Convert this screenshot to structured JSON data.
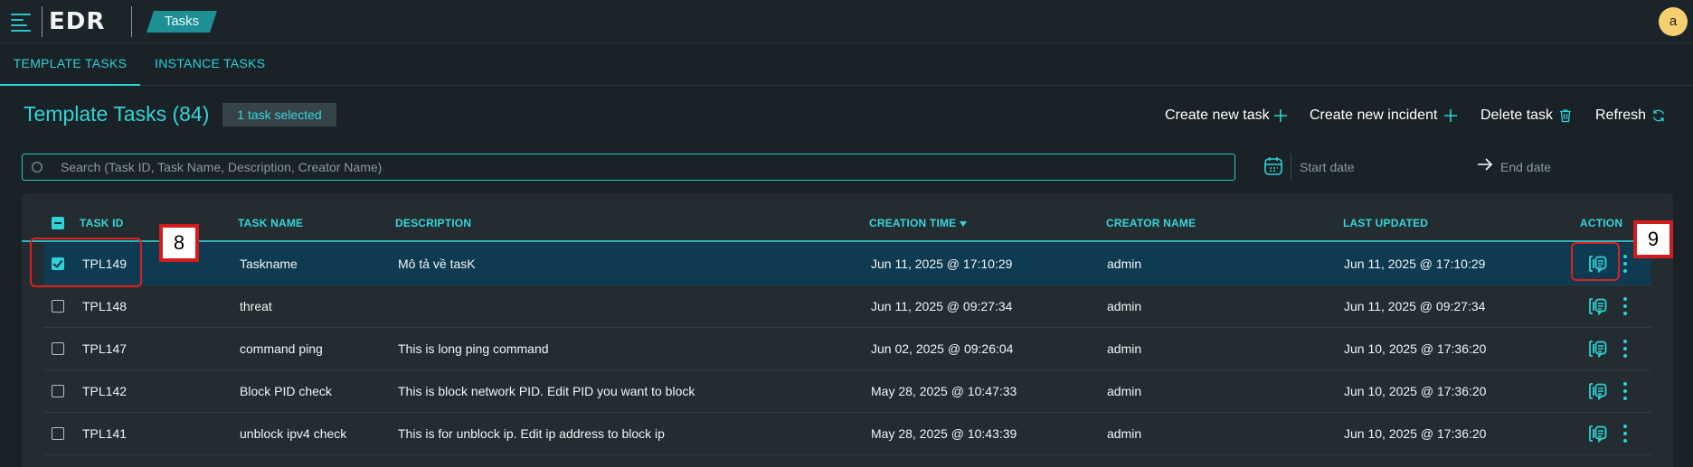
{
  "app": {
    "logo": "EDR",
    "breadcrumb": "Tasks",
    "avatar_initial": "a"
  },
  "tabs": [
    {
      "label": "TEMPLATE TASKS",
      "active": true
    },
    {
      "label": "INSTANCE TASKS",
      "active": false
    }
  ],
  "page": {
    "title": "Template Tasks (84)",
    "selected_badge": "1 task selected"
  },
  "actions": {
    "create_task": "Create new task",
    "create_incident": "Create new incident",
    "delete_task": "Delete task",
    "refresh": "Refresh"
  },
  "search": {
    "placeholder": "Search (Task ID, Task Name, Description, Creator Name)",
    "value": ""
  },
  "date_range": {
    "start_placeholder": "Start date",
    "end_placeholder": "End date"
  },
  "table": {
    "columns": {
      "task_id": "TASK ID",
      "task_name": "TASK NAME",
      "description": "DESCRIPTION",
      "creation_time": "CREATION TIME",
      "creator_name": "CREATOR NAME",
      "last_updated": "LAST UPDATED",
      "action": "ACTION"
    },
    "sort": {
      "column": "creation_time",
      "direction": "desc"
    },
    "rows": [
      {
        "id": "TPL149",
        "name": "Taskname",
        "description": "Mô tả về tasK",
        "created": "Jun 11, 2025 @ 17:10:29",
        "creator": "admin",
        "updated": "Jun 11, 2025 @ 17:10:29",
        "selected": true
      },
      {
        "id": "TPL148",
        "name": "threat",
        "description": "",
        "created": "Jun 11, 2025 @ 09:27:34",
        "creator": "admin",
        "updated": "Jun 11, 2025 @ 09:27:34",
        "selected": false
      },
      {
        "id": "TPL147",
        "name": "command ping",
        "description": "This is long ping command",
        "created": "Jun 02, 2025 @ 09:26:04",
        "creator": "admin",
        "updated": "Jun 10, 2025 @ 17:36:20",
        "selected": false
      },
      {
        "id": "TPL142",
        "name": "Block PID check",
        "description": "This is block network PID. Edit PID you want to block",
        "created": "May 28, 2025 @ 10:47:33",
        "creator": "admin",
        "updated": "Jun 10, 2025 @ 17:36:20",
        "selected": false
      },
      {
        "id": "TPL141",
        "name": "unblock ipv4 check",
        "description": "This is for unblock ip. Edit ip address to block ip",
        "created": "May 28, 2025 @ 10:43:39",
        "creator": "admin",
        "updated": "Jun 10, 2025 @ 17:36:20",
        "selected": false
      }
    ]
  },
  "annotations": {
    "marker_8": "8",
    "marker_9": "9"
  },
  "colors": {
    "accent": "#2ed3d6",
    "background": "#192226",
    "selected_row": "#0e3a52",
    "annotation": "#e02020",
    "avatar": "#f6cf70"
  }
}
